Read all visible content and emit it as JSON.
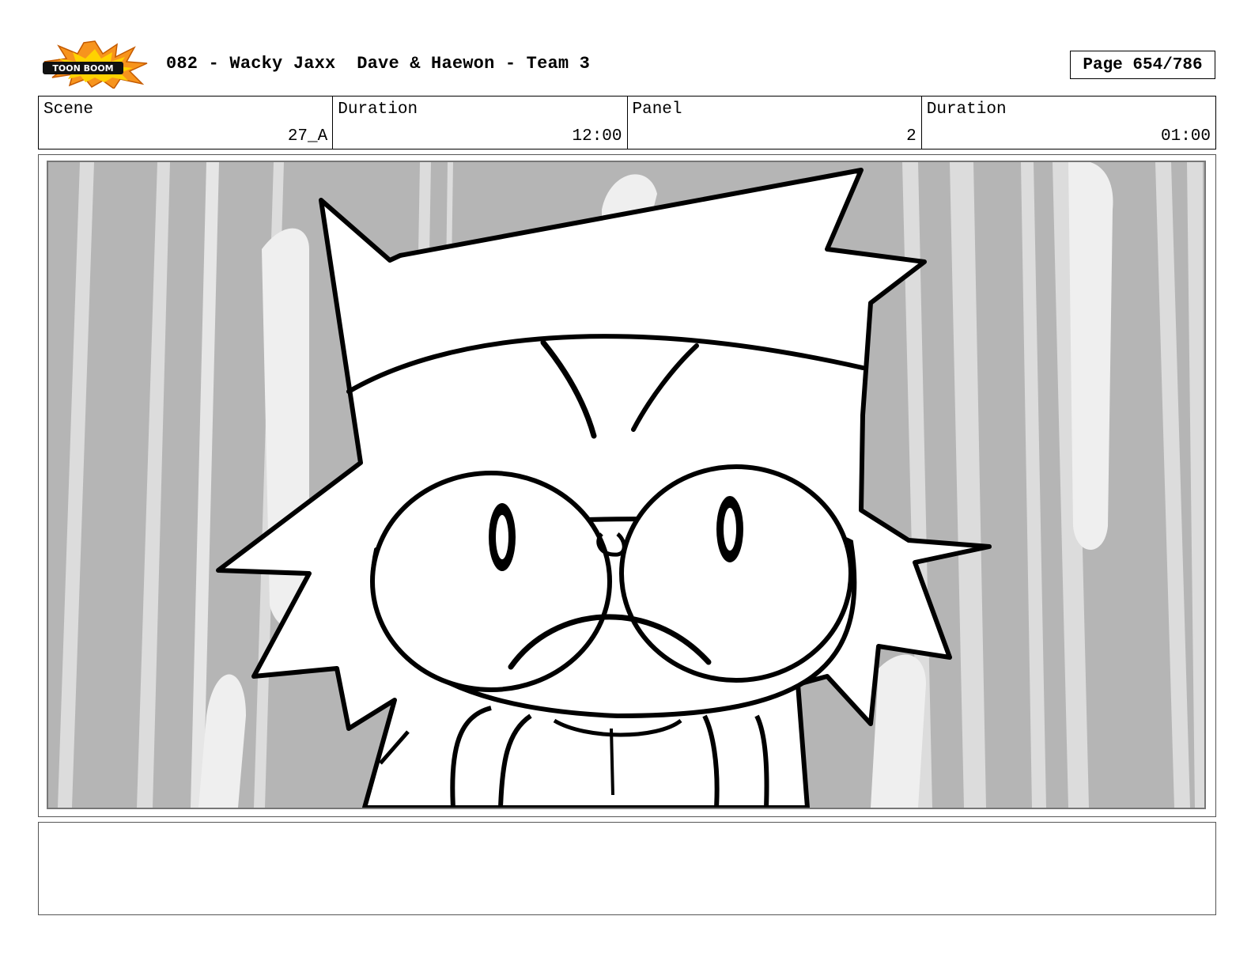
{
  "header": {
    "logo_name": "toon-boom-logo",
    "logo_text": "TOON BOOM",
    "title": "082 - Wacky Jaxx  Dave & Haewon - Team 3",
    "page_label": "Page 654/786"
  },
  "info": {
    "scene_label": "Scene",
    "scene_value": "27_A",
    "scene_duration_label": "Duration",
    "scene_duration_value": "12:00",
    "panel_label": "Panel",
    "panel_value": "2",
    "panel_duration_label": "Duration",
    "panel_duration_value": "01:00"
  },
  "notes": {
    "text": ""
  },
  "colors": {
    "panel_bg": "#b5b5b5",
    "streak_light": "#dcdcdc",
    "streak_white": "#efefef",
    "logo_orange": "#f7941d",
    "logo_yellow": "#ffd200"
  }
}
